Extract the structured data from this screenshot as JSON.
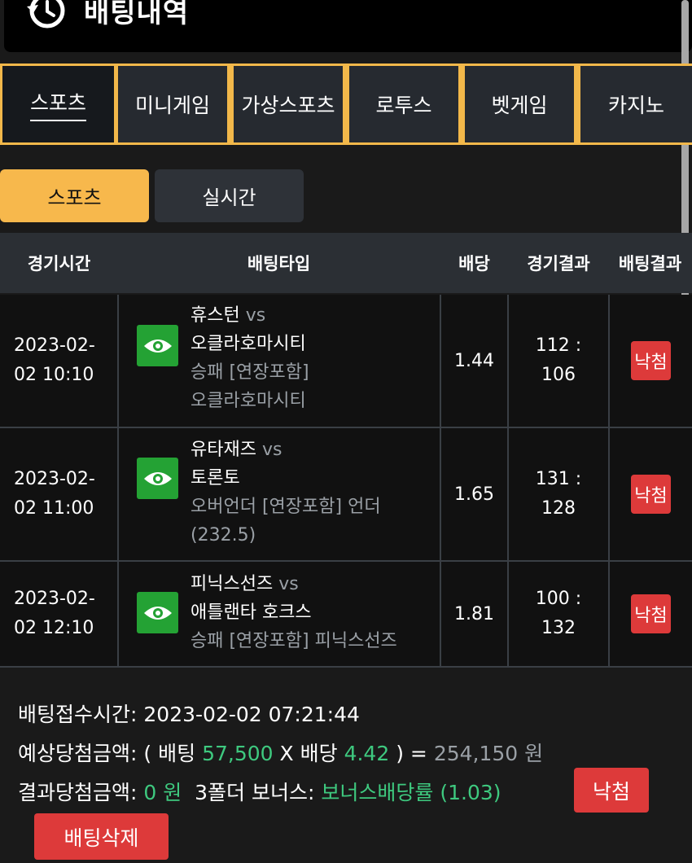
{
  "header": {
    "title": "배팅내역"
  },
  "tabs": [
    {
      "label": "스포츠",
      "active": true
    },
    {
      "label": "미니게임"
    },
    {
      "label": "가상스포츠"
    },
    {
      "label": "로투스"
    },
    {
      "label": "벳게임"
    },
    {
      "label": "카지노"
    }
  ],
  "subtabs": [
    {
      "label": "스포츠",
      "active": true
    },
    {
      "label": "실시간"
    }
  ],
  "table": {
    "headers": [
      "경기시간",
      "배팅타입",
      "배당",
      "경기결과",
      "배팅결과"
    ],
    "rows": [
      {
        "time_line1": "2023-02-",
        "time_line2": "02 10:10",
        "home": "휴스턴",
        "vs": "vs",
        "away": "오클라호마시티",
        "market": "승패 [연장포함]",
        "pick": "오클라호마시티",
        "odds": "1.44",
        "score_line1": "112 :",
        "score_line2": "106",
        "result": "낙첨"
      },
      {
        "time_line1": "2023-02-",
        "time_line2": "02 11:00",
        "home": "유타재즈",
        "vs": "vs",
        "away": "토론토",
        "market": "오버언더 [연장포함] 언더",
        "pick": "(232.5)",
        "odds": "1.65",
        "score_line1": "131 :",
        "score_line2": "128",
        "result": "낙첨"
      },
      {
        "time_line1": "2023-02-",
        "time_line2": "02 12:10",
        "home": "피닉스선즈",
        "vs": "vs",
        "away": "애틀랜타 호크스",
        "market": "승패 [연장포함] 피닉스선즈",
        "pick": "",
        "odds": "1.81",
        "score_line1": "100 :",
        "score_line2": "132",
        "result": "낙첨"
      }
    ]
  },
  "summary": {
    "receipt_label": "배팅접수시간:",
    "receipt_time": "2023-02-02 07:21:44",
    "expected_label": "예상당첨금액:",
    "open_paren": "(",
    "bet_label": "배팅",
    "bet_amount": "57,500",
    "times": "X",
    "odds_label": "배당",
    "total_odds": "4.42",
    "close_eq": ") =",
    "expected_amount": "254,150",
    "won_unit": "원",
    "result_label": "결과당첨금액:",
    "result_amount": "0 원",
    "bonus_label": "3폴더 보너스:",
    "bonus_value": "보너스배당률 (1.03)",
    "status_button": "낙첨",
    "delete_button": "배팅삭제"
  },
  "colors": {
    "accent": "#f2b84a",
    "green": "#3ec97f",
    "red": "#dd3a3a",
    "eye_green": "#24a234"
  },
  "icons": [
    "clock-history-icon",
    "eye-icon"
  ]
}
